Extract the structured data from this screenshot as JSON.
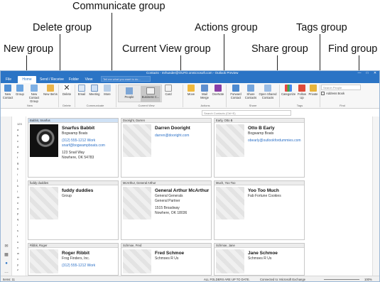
{
  "callouts": {
    "communicate": "Communicate group",
    "delete": "Delete group",
    "new": "New group",
    "actions": "Actions group",
    "tags": "Tags group",
    "current_view": "Current View group",
    "share": "Share group",
    "find": "Find group"
  },
  "window": {
    "title": "Contacts - mrhunder@OUFD.onmicrosoft.com - Outlook Preview",
    "tabs": [
      "File",
      "Home",
      "Send / Receive",
      "Folder",
      "View"
    ],
    "tell_me": "Tell me what you want to do...",
    "controls": [
      "—",
      "□",
      "✕"
    ]
  },
  "ribbon": {
    "new_contact": "New Contact",
    "group": "Group",
    "new_contact_group": "New Contact Group",
    "new_items": "New Items",
    "delete": "Delete",
    "email": "Email",
    "meeting": "Meeting",
    "more": "More",
    "people": "People",
    "business_card": "Business C...",
    "card": "Card",
    "move": "Move",
    "mail_merge": "Mail Merge",
    "onenote": "OneNote",
    "forward_contact": "Forward Contact",
    "share_contacts": "Share Contacts",
    "open_shared_contacts": "Open Shared Contacts",
    "categorize": "Categorize",
    "follow_up": "Follow Up",
    "private": "Private",
    "search_people": "Search People",
    "address_book": "Address Book",
    "groups": {
      "new": "New",
      "delete": "Delete",
      "communicate": "Communicate",
      "current_view": "Current View",
      "actions": "Actions",
      "share": "Share",
      "tags": "Tags",
      "find": "Find"
    }
  },
  "search_contacts_placeholder": "Search Contacts (Ctrl+E)",
  "alphabet": [
    "123",
    "a",
    "b",
    "c",
    "d",
    "e",
    "f",
    "g",
    "h",
    "i",
    "j",
    "k",
    "l",
    "m",
    "n",
    "o",
    "p",
    "q",
    "r",
    "s",
    "t",
    "u",
    "v",
    "w",
    "x",
    "y",
    "z"
  ],
  "cards": [
    {
      "header": "Babbit, Snarfus",
      "name": "Snarfus Babbit",
      "lines": [
        "Bogwamp Boats"
      ],
      "blue": [
        "(312) 555-1212 Work",
        "snarf@bogwampboats.com"
      ],
      "after": [
        "123 Snail Way",
        "Nowhere, OK 54783"
      ],
      "photo": true,
      "selected": true
    },
    {
      "header": "Dooright, Darren",
      "name": "Darren Dooright",
      "lines": [],
      "blue": [
        "darren@dooright.com"
      ],
      "after": []
    },
    {
      "header": "Early, Otto B",
      "name": "Otto B Early",
      "lines": [
        "Bogwamp Boats"
      ],
      "blue": [
        "obearly@outlookfordummies.com"
      ],
      "after": []
    },
    {
      "header": "fuddy duddies",
      "name": "fuddy duddies",
      "lines": [
        "Group"
      ],
      "blue": [],
      "after": []
    },
    {
      "header": "McArthur, General Arthur",
      "name": "General Arthur McArthur",
      "lines": [
        "General Generals",
        "General Partner"
      ],
      "blue": [],
      "after": [
        "1515 Broadway",
        "Nowhere, OK 18036"
      ]
    },
    {
      "header": "Much, Yoo Too",
      "name": "Yoo Too Much",
      "lines": [
        "Fab Fortune Cookies"
      ],
      "blue": [],
      "after": []
    },
    {
      "header": "Ribbit, Roger",
      "name": "Roger Ribbit",
      "lines": [
        "Frog Finders, Inc."
      ],
      "blue": [
        "(312) 555-1212 Work"
      ],
      "after": []
    },
    {
      "header": "Schmoe, Fred",
      "name": "Fred Schmoe",
      "lines": [
        "Schmoes R Us"
      ],
      "blue": [],
      "after": []
    },
    {
      "header": "Schmoe, Jane",
      "name": "Jane Schmoe",
      "lines": [
        "Schmoes R Us"
      ],
      "blue": [],
      "after": []
    }
  ],
  "status": {
    "items": "Items: 11",
    "folders": "ALL FOLDERS ARE UP TO DATE.",
    "connected": "Connected to: Microsoft Exchange",
    "zoom": "100%"
  }
}
